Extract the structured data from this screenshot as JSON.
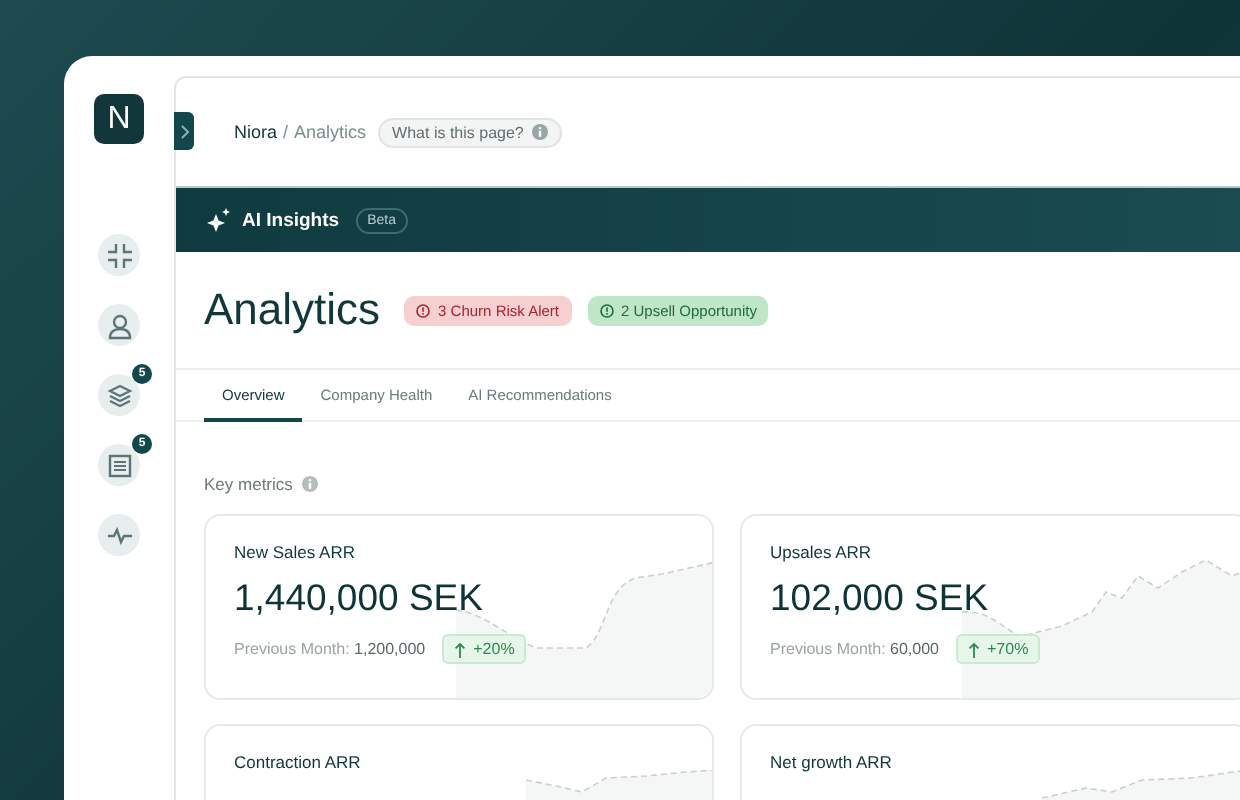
{
  "sidebar": {
    "logo": "N",
    "items": [
      {
        "has_badge": false
      },
      {
        "has_badge": false
      },
      {
        "has_badge": true,
        "badge": "5"
      },
      {
        "has_badge": true,
        "badge": "5"
      },
      {
        "has_badge": false
      }
    ]
  },
  "header": {
    "parent": "Niora",
    "separator": "/",
    "current": "Analytics",
    "help": "What is this page?"
  },
  "ai_bar": {
    "title": "AI Insights",
    "badge": "Beta"
  },
  "page": {
    "title": "Analytics",
    "alerts": [
      {
        "label": "3 Churn Risk Alert",
        "kind": "danger"
      },
      {
        "label": "2 Upsell Opportunity",
        "kind": "success"
      }
    ]
  },
  "tabs": [
    {
      "label": "Overview",
      "selected": true
    },
    {
      "label": "Company Health",
      "selected": false
    },
    {
      "label": "AI Recommendations",
      "selected": false
    }
  ],
  "section": {
    "title": "Key metrics"
  },
  "metrics": [
    {
      "title": "New Sales ARR",
      "value": "1,440,000 SEK",
      "previous_label": "Previous Month:",
      "previous_value": "1,200,000",
      "change": "+20%"
    },
    {
      "title": "Upsales ARR",
      "value": "102,000 SEK",
      "previous_label": "Previous Month:",
      "previous_value": "60,000",
      "change": "+70%"
    },
    {
      "title": "Contraction ARR"
    },
    {
      "title": "Net growth ARR"
    }
  ]
}
